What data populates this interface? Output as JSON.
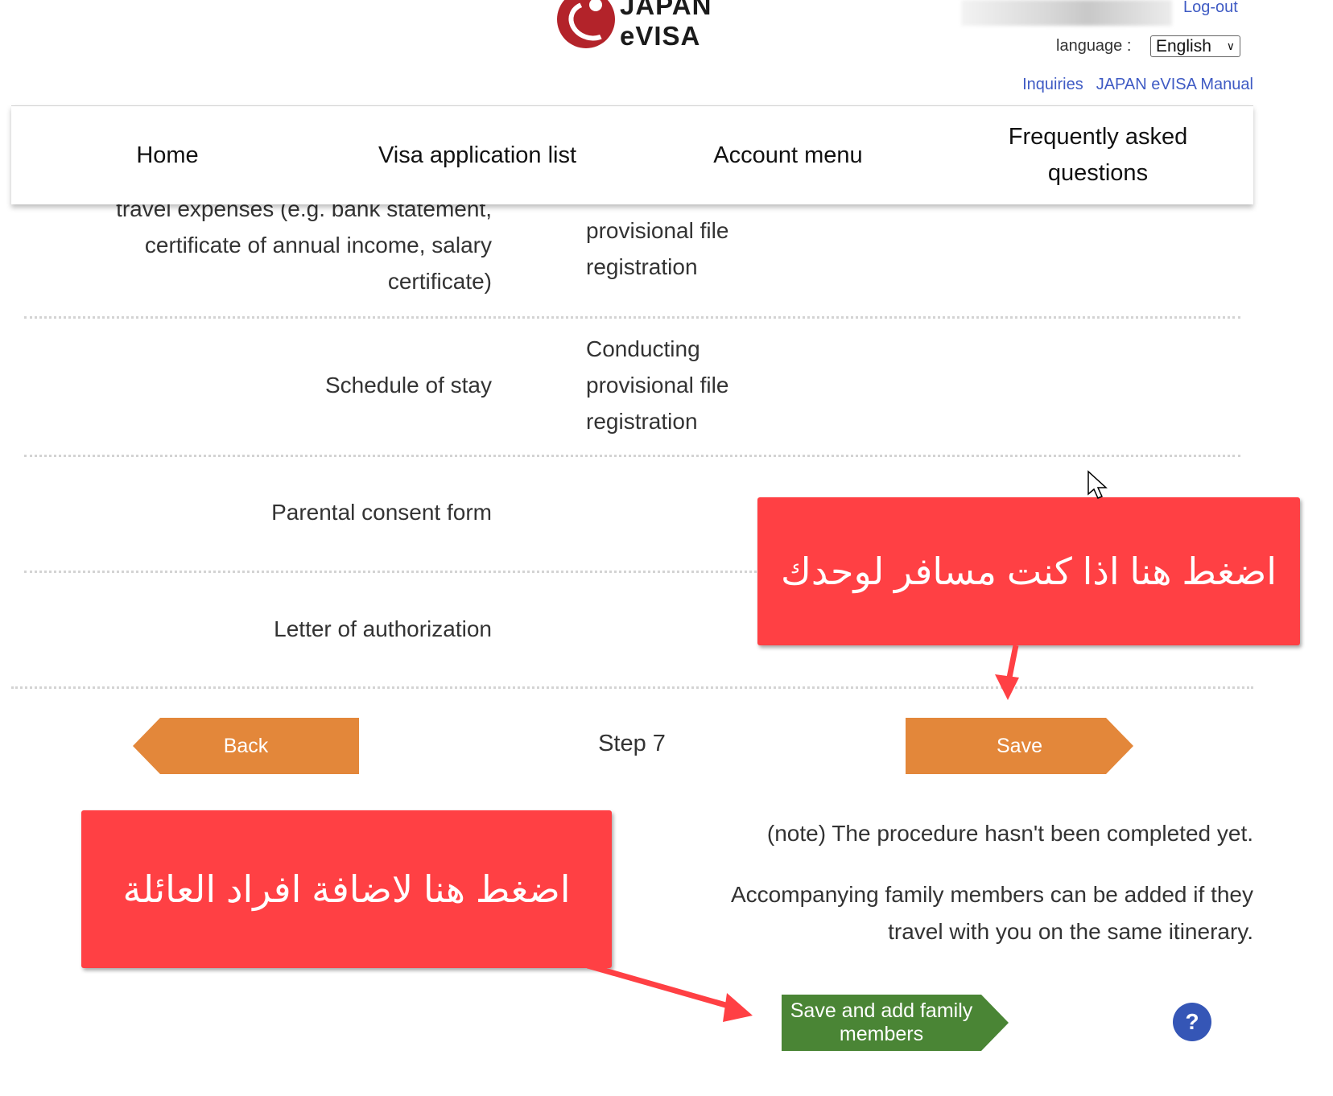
{
  "header": {
    "logo_line1": "JAPAN",
    "logo_line2": "eVISA",
    "logout_label": "Log-out",
    "language_label": "language :",
    "language_selected": "English",
    "links": [
      "Inquiries",
      "JAPAN eVISA Manual"
    ]
  },
  "nav": {
    "items": [
      "Home",
      "Visa application list",
      "Account menu",
      "Frequently asked questions"
    ]
  },
  "rows": [
    {
      "label": "travel expenses (e.g. bank statement, certificate of annual income, salary certificate)",
      "value": "provisional file registration"
    },
    {
      "label": "Schedule of stay",
      "value": "Conducting provisional file registration"
    },
    {
      "label": "Parental consent form",
      "value": ""
    },
    {
      "label": "Letter of authorization",
      "value": ""
    }
  ],
  "actions": {
    "back_label": "Back",
    "step_label": "Step 7",
    "save_label": "Save",
    "save_family_label": "Save and add family members",
    "help_label": "?"
  },
  "notes": {
    "note1": "(note) The procedure hasn't been completed yet.",
    "note2": "Accompanying family members can be added if they travel with you on the same itinerary."
  },
  "annotations": {
    "callout_solo": "اضغط هنا اذا كنت مسافر لوحدك",
    "callout_family": "اضغط هنا لاضافة افراد العائلة",
    "callout_color": "#ff4044"
  },
  "colors": {
    "link": "#3f5bc4",
    "orange_button": "#e3873a",
    "green_button": "#4a8535",
    "help_button": "#3556b6",
    "logo_red": "#b3232a"
  }
}
